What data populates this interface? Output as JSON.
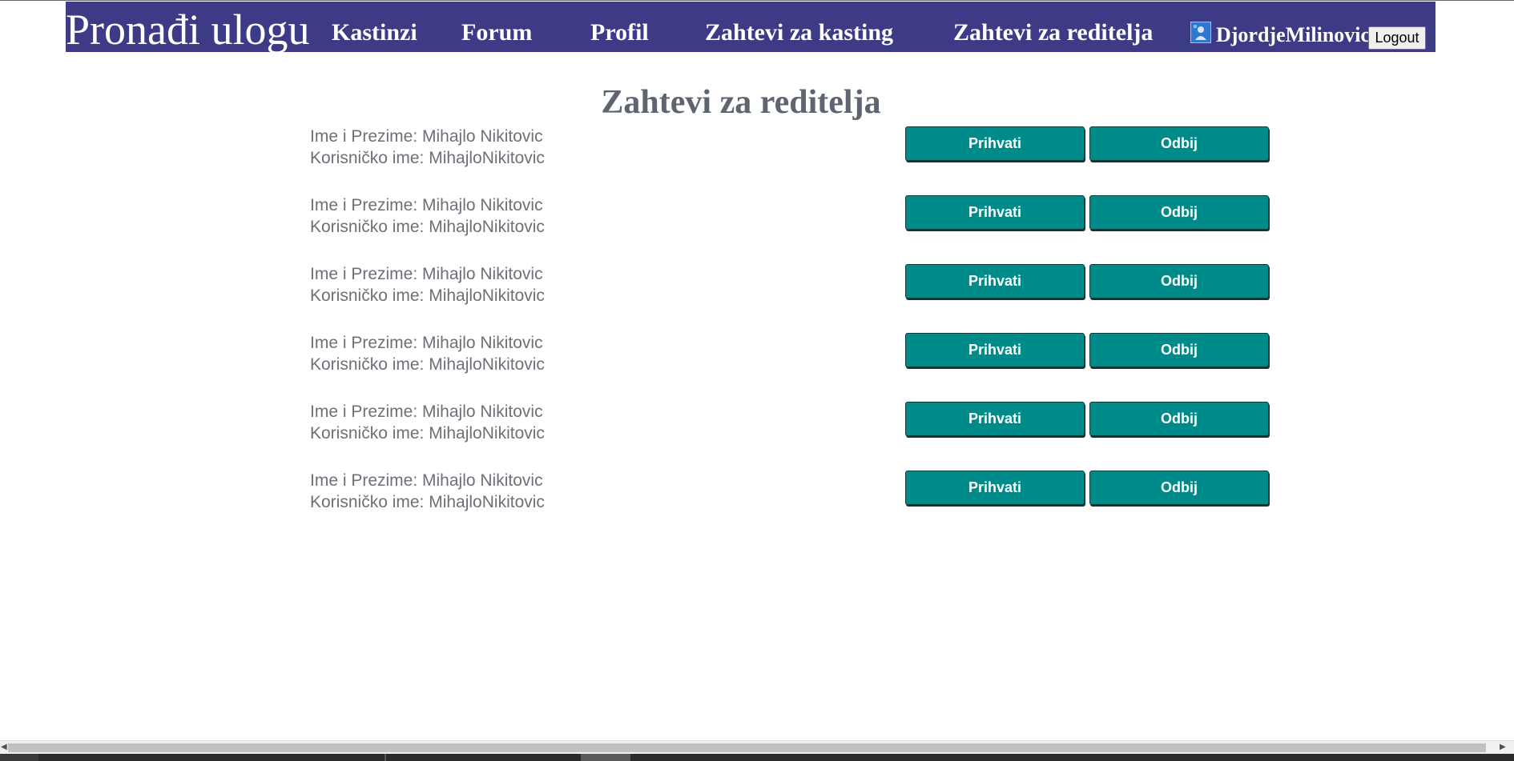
{
  "navbar": {
    "brand": "Pronađi ulogu",
    "links": [
      "Kastinzi",
      "Forum",
      "Profil",
      "Zahtevi za kasting",
      "Zahtevi za reditelja"
    ],
    "username": "DjordjeMilinovic",
    "logout_label": "Logout",
    "background": "#3d3a86"
  },
  "page": {
    "title": "Zahtevi za reditelja"
  },
  "requests": [
    {
      "name_line": "Ime i Prezime: Mihajlo Nikitovic",
      "username_line": "Korisničko ime: MihajloNikitovic",
      "accept_label": "Prihvati",
      "reject_label": "Odbij"
    },
    {
      "name_line": "Ime i Prezime: Mihajlo Nikitovic",
      "username_line": "Korisničko ime: MihajloNikitovic",
      "accept_label": "Prihvati",
      "reject_label": "Odbij"
    },
    {
      "name_line": "Ime i Prezime: Mihajlo Nikitovic",
      "username_line": "Korisničko ime: MihajloNikitovic",
      "accept_label": "Prihvati",
      "reject_label": "Odbij"
    },
    {
      "name_line": "Ime i Prezime: Mihajlo Nikitovic",
      "username_line": "Korisničko ime: MihajloNikitovic",
      "accept_label": "Prihvati",
      "reject_label": "Odbij"
    },
    {
      "name_line": "Ime i Prezime: Mihajlo Nikitovic",
      "username_line": "Korisničko ime: MihajloNikitovic",
      "accept_label": "Prihvati",
      "reject_label": "Odbij"
    },
    {
      "name_line": "Ime i Prezime: Mihajlo Nikitovic",
      "username_line": "Korisničko ime: MihajloNikitovic",
      "accept_label": "Prihvati",
      "reject_label": "Odbij"
    }
  ],
  "colors": {
    "button": "#008b8b",
    "text_gray": "#6c7077"
  }
}
